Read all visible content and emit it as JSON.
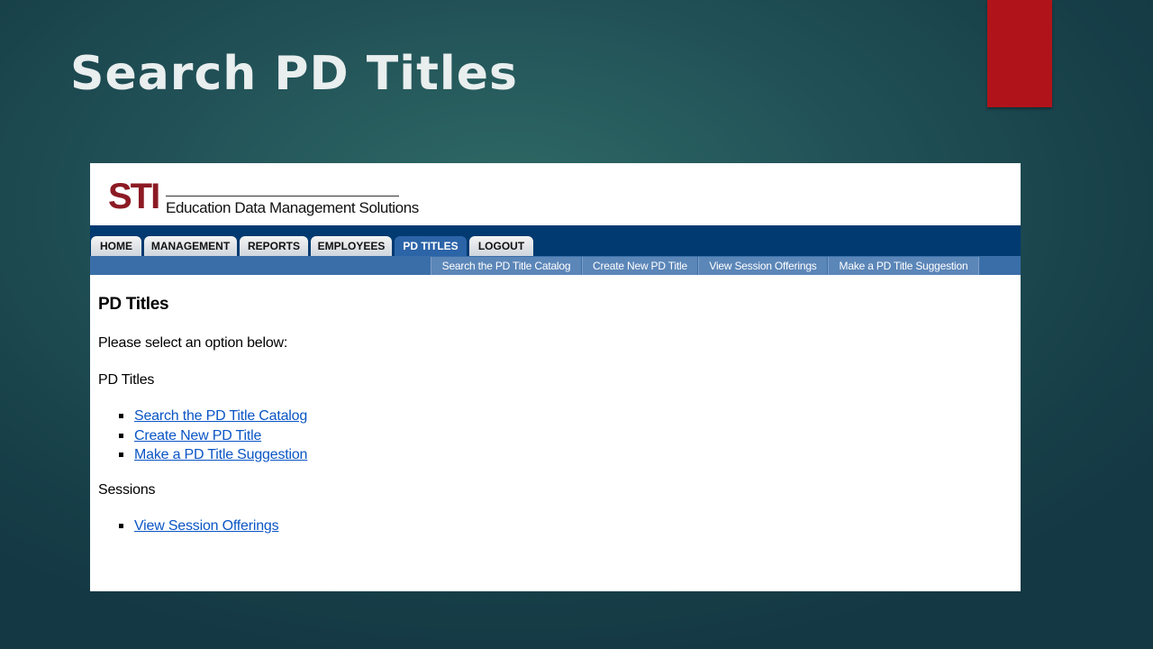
{
  "slide": {
    "title": "Search PD Titles",
    "accent_color": "#b0141a"
  },
  "app": {
    "logo": {
      "brand": "STI",
      "tagline": "Education Data Management Solutions"
    },
    "tabs": [
      {
        "label": "HOME",
        "active": false
      },
      {
        "label": "MANAGEMENT",
        "active": false
      },
      {
        "label": "REPORTS",
        "active": false
      },
      {
        "label": "EMPLOYEES",
        "active": false
      },
      {
        "label": "PD TITLES",
        "active": true
      },
      {
        "label": "LOGOUT",
        "active": false
      }
    ],
    "subtabs": [
      {
        "label": "Search the PD Title Catalog"
      },
      {
        "label": "Create New PD Title"
      },
      {
        "label": "View Session Offerings"
      },
      {
        "label": "Make a PD Title Suggestion"
      }
    ],
    "content": {
      "heading": "PD Titles",
      "instruction": "Please select an option below:",
      "sections": [
        {
          "title": "PD Titles",
          "links": [
            {
              "label": "Search the PD Title Catalog"
            },
            {
              "label": "Create New PD Title"
            },
            {
              "label": "Make a PD Title Suggestion"
            }
          ]
        },
        {
          "title": "Sessions",
          "links": [
            {
              "label": "View Session Offerings"
            }
          ]
        }
      ]
    }
  }
}
